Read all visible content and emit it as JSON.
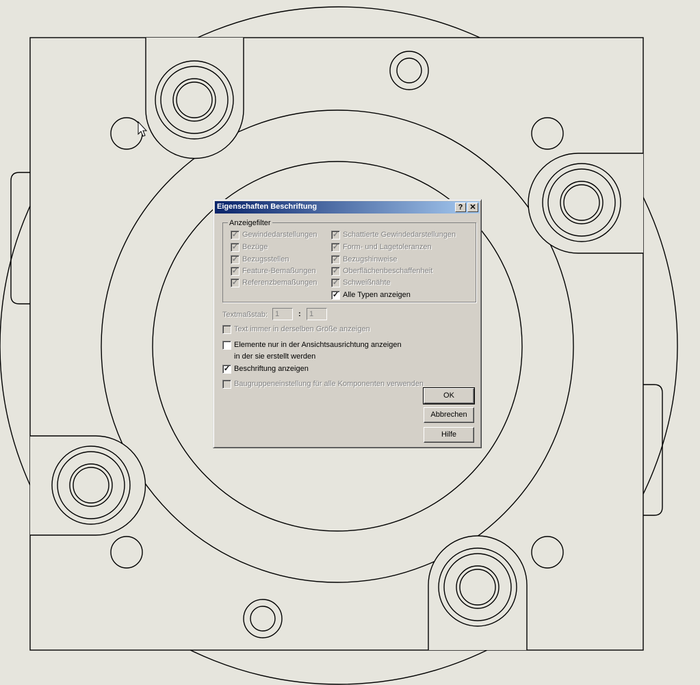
{
  "dialog": {
    "title": "Eigenschaften Beschriftung",
    "help_glyph": "?",
    "close_glyph": "✕",
    "display_filter": {
      "label": "Anzeigefilter",
      "left_items": [
        {
          "label": "Gewindedarstellungen",
          "checked": true,
          "enabled": false
        },
        {
          "label": "Bezüge",
          "checked": true,
          "enabled": false
        },
        {
          "label": "Bezugsstellen",
          "checked": true,
          "enabled": false
        },
        {
          "label": "Feature-Bemaßungen",
          "checked": true,
          "enabled": false
        },
        {
          "label": "Referenzbemaßungen",
          "checked": true,
          "enabled": false
        }
      ],
      "right_items": [
        {
          "label": "Schattierte Gewindedarstellungen",
          "checked": true,
          "enabled": false
        },
        {
          "label": "Form- und Lagetoleranzen",
          "checked": true,
          "enabled": false
        },
        {
          "label": "Bezugshinweise",
          "checked": true,
          "enabled": false
        },
        {
          "label": "Oberflächenbeschaffenheit",
          "checked": true,
          "enabled": false
        },
        {
          "label": "Schweißnähte",
          "checked": true,
          "enabled": false
        },
        {
          "label": "Alle Typen anzeigen",
          "checked": true,
          "enabled": true
        }
      ]
    },
    "text_scale": {
      "label": "Textmaßstab:",
      "value1": "1",
      "separator": ":",
      "value2": "1"
    },
    "options": {
      "same_size": {
        "label": "Text immer in derselben Größe anzeigen",
        "checked": false,
        "enabled": false
      },
      "view_orientation": {
        "label_line1": "Elemente nur in der Ansichtsausrichtung anzeigen",
        "label_line2": "in der sie erstellt werden",
        "checked": false,
        "enabled": true
      },
      "show_annotations": {
        "label": "Beschriftung anzeigen",
        "checked": true,
        "enabled": true
      },
      "assembly_setting": {
        "label": "Baugruppeneinstellung für alle Komponenten verwenden",
        "checked": false,
        "enabled": false
      }
    },
    "buttons": {
      "ok": "OK",
      "cancel": "Abbrechen",
      "help": "Hilfe"
    }
  },
  "check_glyph": "✓"
}
